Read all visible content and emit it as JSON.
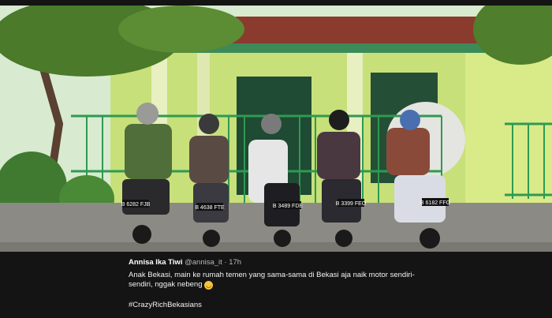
{
  "tweet": {
    "author_name": "Annisa Ika Tiwi",
    "author_handle": "@annisa_it",
    "separator": "·",
    "timestamp": "17h",
    "text": "Anak Bekasi, main ke rumah temen yang sama-sama di Bekasi aja naik motor sendiri-sendiri, nggak nebeng",
    "emoji": "upside-down-face-emoji",
    "emoji_glyph": "◡",
    "hashtag": "#CrazyRichBekasians"
  },
  "photo": {
    "plates": [
      "B 6282 FJB",
      "B 4638 FTE",
      "B 3489 FDE",
      "B 3399 FEO",
      "B 6182 FFG"
    ]
  },
  "colors": {
    "house_wall": "#c7e07a",
    "gate": "#2e9a52",
    "roof": "#8a3b2e",
    "ground": "#8c8a84",
    "panel_bg": "#141414"
  }
}
